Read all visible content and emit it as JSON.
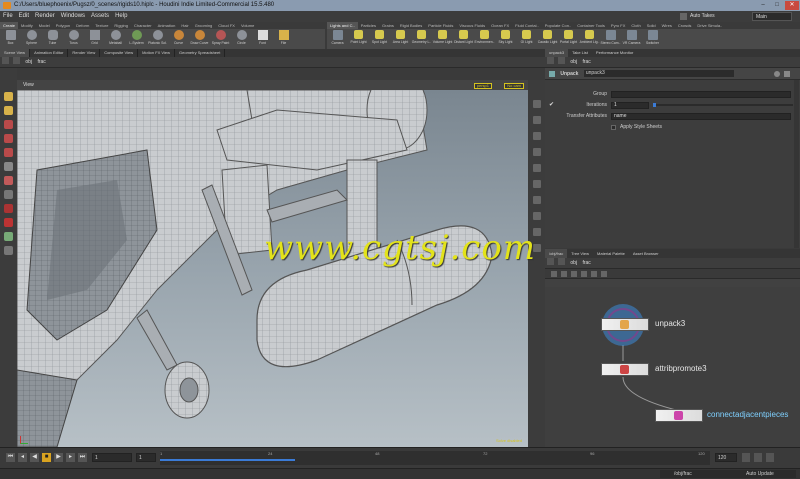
{
  "window": {
    "title": "C:/Users/bluephoenix/Pugsz/0_scenes/rigids10.hiplc - Houdini Indie Limited-Commercial 15.5.480"
  },
  "menu": [
    "File",
    "Edit",
    "Render",
    "Windows",
    "Assets",
    "Help"
  ],
  "top_right": {
    "auto_takes": "Auto Takes",
    "desktop": "Main"
  },
  "shelf_left": {
    "tabs": [
      "Create",
      "Modify",
      "Model",
      "Polygon",
      "Deform",
      "Texture",
      "Rigging",
      "Character",
      "Animation",
      "Hair",
      "Grooming",
      "Cloud FX",
      "Volume"
    ],
    "tools": [
      "Box",
      "Sphere",
      "Tube",
      "Torus",
      "Grid",
      "Metaball",
      "L-System",
      "Platonic Sol.",
      "Curve",
      "Draw Curve",
      "Spray Paint",
      "Circle",
      "Font",
      "File"
    ]
  },
  "shelf_right": {
    "tabs": [
      "Lights and C..",
      "Particles",
      "Grains",
      "Rigid Bodies",
      "Particle Fluids",
      "Viscous Fluids",
      "Ocean FX",
      "Fluid Contai..",
      "Populate Con..",
      "Container Tools",
      "Pyro FX",
      "Cloth",
      "Solid",
      "Wires",
      "Crowds",
      "Drive Simula.."
    ],
    "tools": [
      "Camera",
      "Point Light",
      "Spot Light",
      "Area Light",
      "Geometry L..",
      "Volume Light",
      "Distant Light",
      "Environmen..",
      "Sky Light",
      "GI Light",
      "Caustic Light",
      "Portal Light",
      "Ambient Lig..",
      "Stereo Cam..",
      "VR Camera",
      "Switcher"
    ]
  },
  "viewer_tabs": [
    "Scene View",
    "Animation Editor",
    "Render View",
    "Composite View",
    "Motion FX View",
    "Geometry Spreadsheet"
  ],
  "viewer_path": "obj",
  "viewer_node": "frac",
  "viewport": {
    "label": "View",
    "persp": "persp1",
    "cam": "No cam",
    "status": "Solve disabled"
  },
  "watermark": "www.cgtsj.com",
  "parm_tabs": [
    "unpack3",
    "Take List",
    "Performance Monitor"
  ],
  "parm_path": "obj",
  "parm_node": "frac",
  "parm": {
    "type": "Unpack",
    "name": "unpack3",
    "group_label": "Group",
    "iterations_label": "Iterations",
    "iterations_value": "1",
    "transfer_label": "Transfer Attributes",
    "transfer_value": "name",
    "style_label": "Apply Style Sheets"
  },
  "network_tabs": [
    "/obj/frac",
    "Tree View",
    "Material Palette",
    "Asset Browser"
  ],
  "network_path": "obj",
  "network_node": "frac",
  "nodes": [
    "unpack3",
    "attribpromote3",
    "connectadjacentpieces"
  ],
  "timeline": {
    "frame": "1",
    "start": "1",
    "end": "120",
    "ticks": [
      "1",
      "24",
      "48",
      "72",
      "96",
      "120"
    ]
  },
  "status": {
    "path": "/obj/frac",
    "auto_update": "Auto Update"
  },
  "colors": {
    "accent": "#3b7bd6",
    "watermark": "#e3e31a",
    "node_highlight": "#3d8bd8",
    "node_ring": "#8a3a8a"
  }
}
